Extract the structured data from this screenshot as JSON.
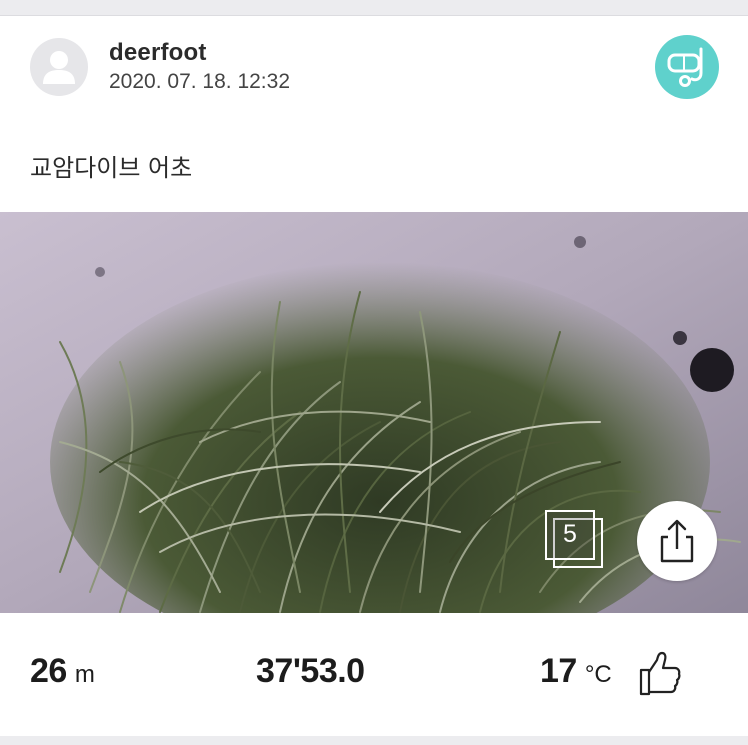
{
  "post": {
    "username": "deerfoot",
    "timestamp": "2020. 07. 18. 12:32",
    "caption": "교암다이브 어초",
    "photo_count": "5"
  },
  "stats": {
    "depth_value": "26",
    "depth_unit": "m",
    "coordinate": "37'53.0",
    "temperature_value": "17",
    "temperature_unit": "°C"
  },
  "icons": {
    "avatar": "user-avatar-placeholder-icon",
    "badge": "diver-mask-snorkel-icon",
    "photos": "photo-stack-icon",
    "share": "share-icon",
    "like": "thumbs-up-icon"
  },
  "colors": {
    "badge_bg": "#5fd1cc",
    "page_bg": "#ffffff",
    "strip_bg": "#ececef"
  }
}
